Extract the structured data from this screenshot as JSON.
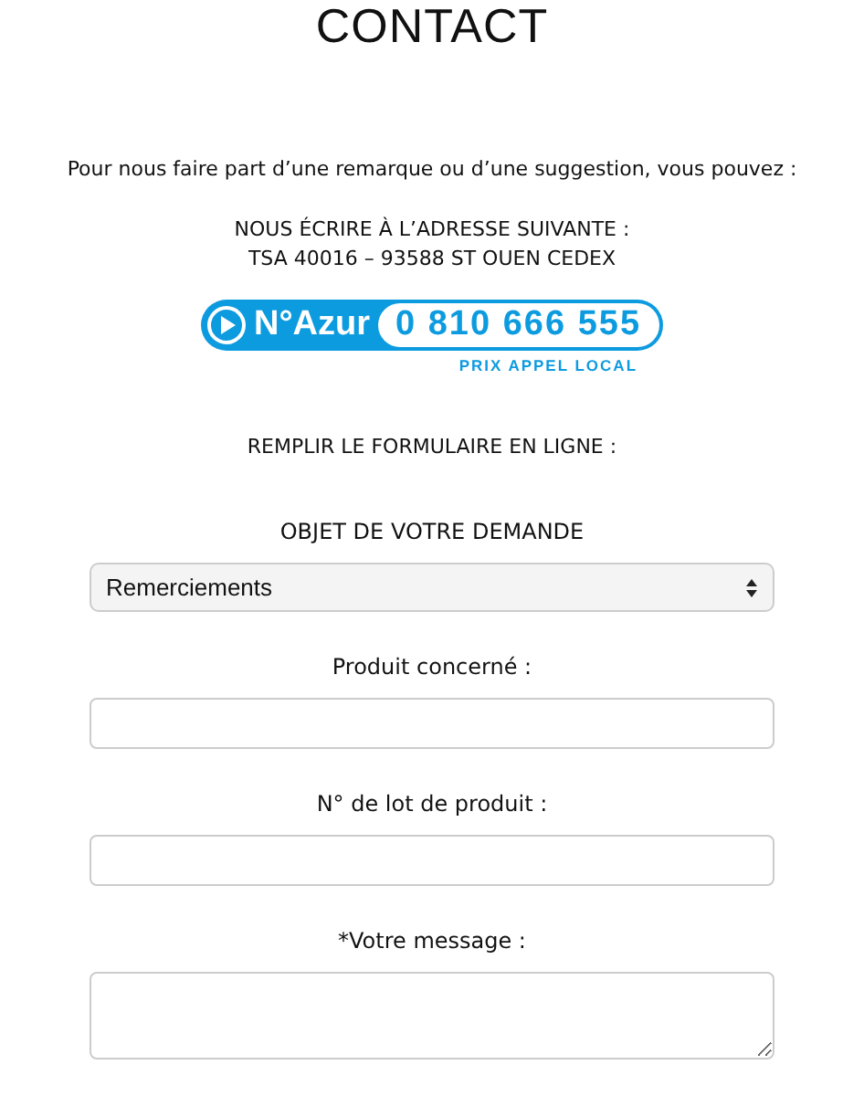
{
  "title": "CONTACT",
  "intro": "Pour nous faire part d’une remarque ou d’une suggestion, vous pouvez :",
  "address": {
    "heading": "NOUS ÉCRIRE À L’ADRESSE SUIVANTE :",
    "line": "TSA 40016 – 93588 ST OUEN CEDEX"
  },
  "phone_badge": {
    "brand": "N°Azur",
    "number": "0 810 666 555",
    "tagline": "PRIX APPEL LOCAL"
  },
  "form_heading": "REMPLIR LE FORMULAIRE EN LIGNE :",
  "fields": [
    {
      "kind": "select",
      "label": "OBJET DE VOTRE DEMANDE",
      "value": "Remerciements"
    },
    {
      "kind": "input",
      "label": "Produit concerné :"
    },
    {
      "kind": "input",
      "label": "N° de lot de produit :"
    },
    {
      "kind": "textarea",
      "label": "*Votre message :"
    }
  ]
}
